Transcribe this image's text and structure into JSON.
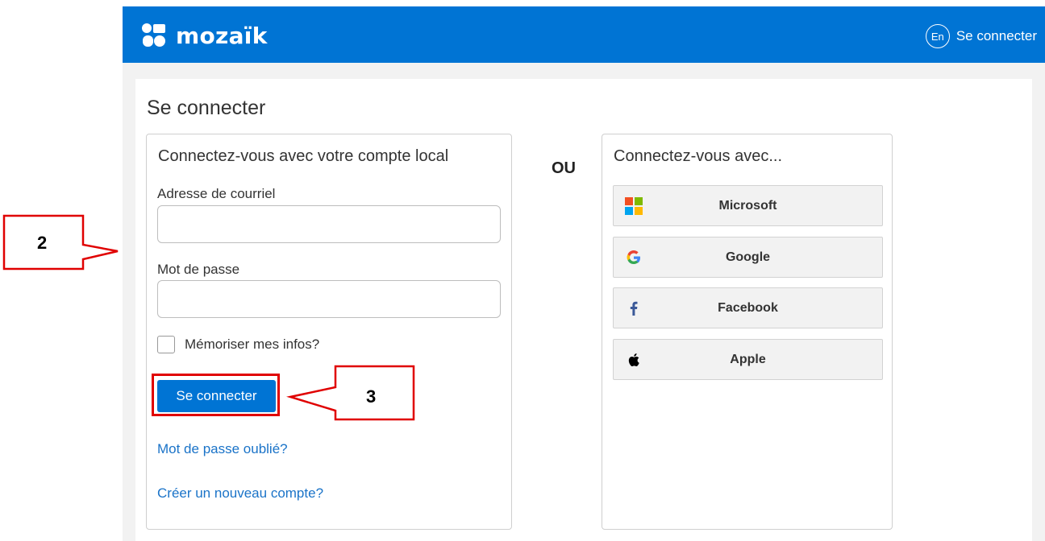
{
  "header": {
    "logo_text": "mozaïk",
    "lang_label": "En",
    "signin_link": "Se connecter",
    "bg_color": "#0074d4"
  },
  "main": {
    "page_title": "Se connecter",
    "local": {
      "heading": "Connectez-vous avec votre compte local",
      "email_label": "Adresse de courriel",
      "email_value": "",
      "password_label": "Mot de passe",
      "password_value": "",
      "remember_label": "Mémoriser mes infos?",
      "remember_checked": false,
      "submit_label": "Se connecter",
      "forgot_link": "Mot de passe oublié?",
      "create_link": "Créer un nouveau compte?"
    },
    "separator": "OU",
    "social": {
      "heading": "Connectez-vous avec...",
      "providers": [
        {
          "label": "Microsoft",
          "icon": "microsoft-icon"
        },
        {
          "label": "Google",
          "icon": "google-icon"
        },
        {
          "label": "Facebook",
          "icon": "facebook-icon"
        },
        {
          "label": "Apple",
          "icon": "apple-icon"
        }
      ]
    }
  },
  "annotations": {
    "callout_2": "2",
    "callout_3": "3",
    "color": "#e00000"
  }
}
